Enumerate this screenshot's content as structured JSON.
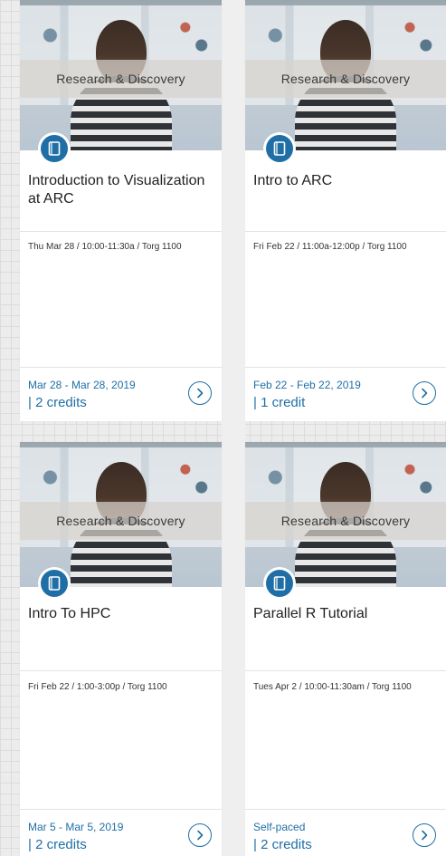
{
  "courses": [
    {
      "category": "Research & Discovery",
      "title": "Introduction to Visualization at ARC",
      "session": "Thu Mar 28 / 10:00-11:30a / Torg 1100",
      "dates": "Mar 28 - Mar 28, 2019",
      "credits": "| 2 credits"
    },
    {
      "category": "Research & Discovery",
      "title": "Intro to ARC",
      "session": "Fri Feb 22 / 11:00a-12:00p / Torg 1100",
      "dates": "Feb 22 - Feb 22, 2019",
      "credits": "| 1 credit"
    },
    {
      "category": "Research & Discovery",
      "title": "Intro To HPC",
      "session": "Fri Feb 22 / 1:00-3:00p / Torg 1100",
      "dates": "Mar 5 - Mar 5, 2019",
      "credits": "| 2 credits"
    },
    {
      "category": "Research & Discovery",
      "title": "Parallel R Tutorial",
      "session": "Tues Apr 2 / 10:00-11:30am / Torg 1100",
      "dates": "Self-paced",
      "credits": "| 2 credits"
    }
  ],
  "icons": {
    "badge": "book-icon",
    "action": "chevron-right-circle-icon"
  },
  "colors": {
    "accent": "#1f6fa6",
    "card_bg": "#ffffff",
    "page_bg": "#ececec"
  }
}
